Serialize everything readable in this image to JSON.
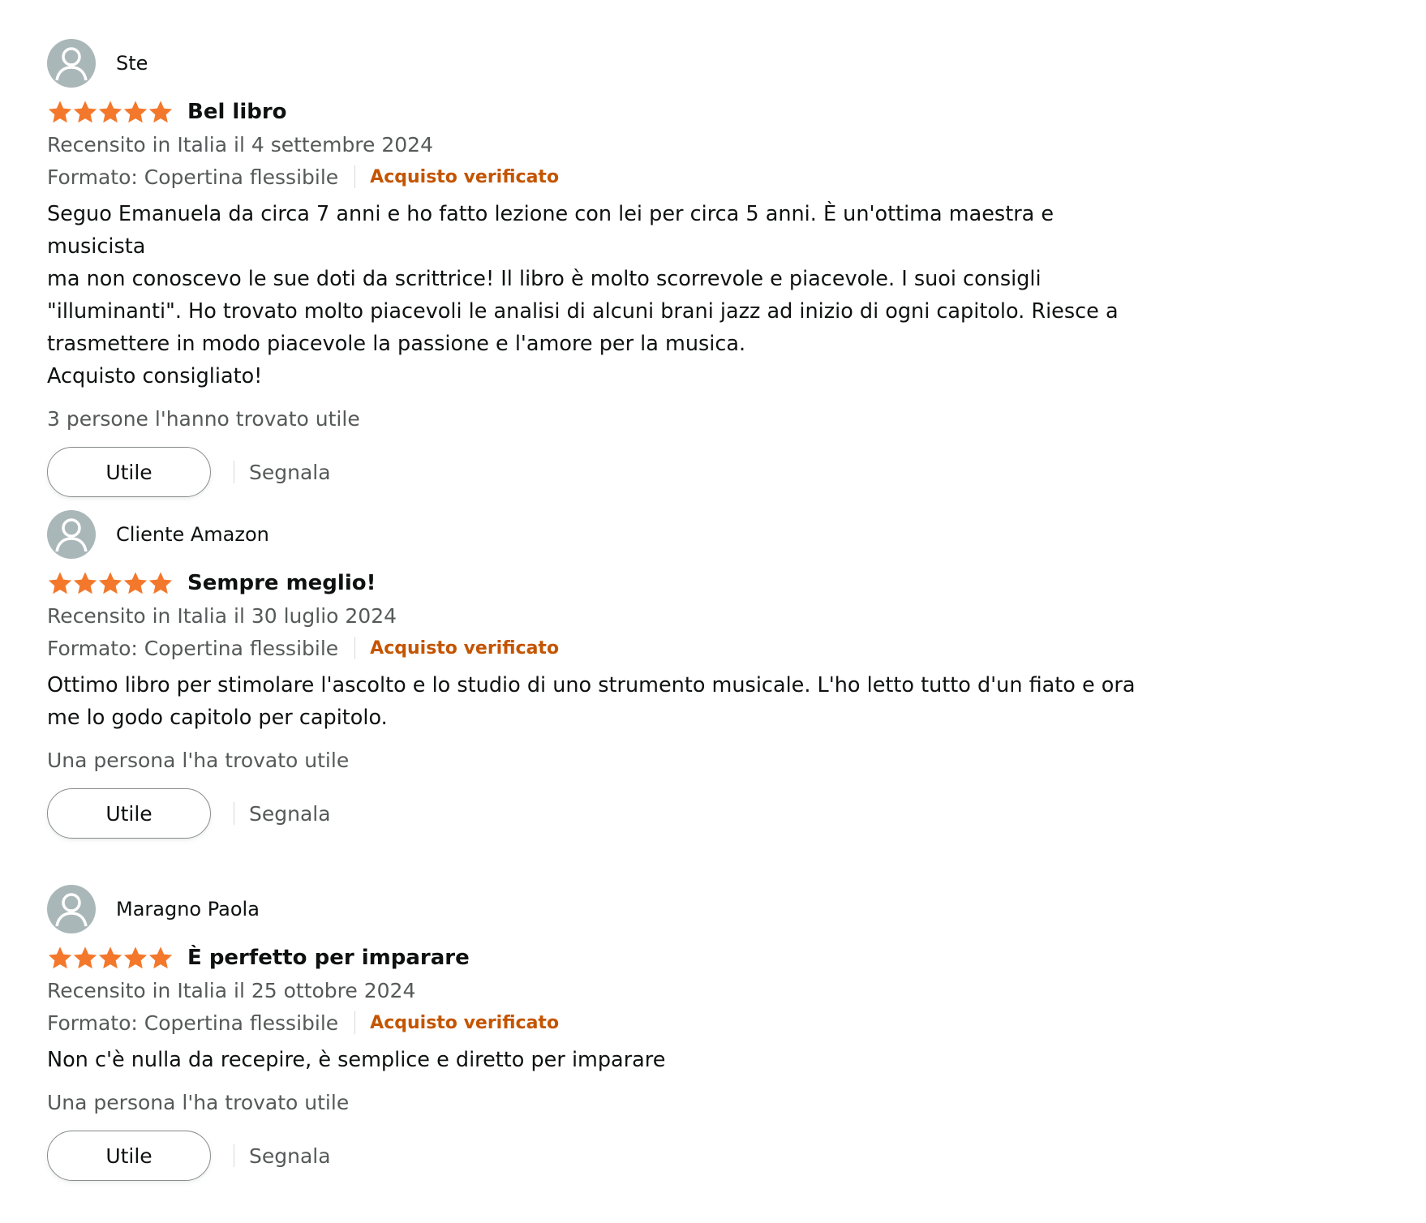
{
  "reviews": [
    {
      "author": "Ste",
      "rating": 5,
      "title": "Bel libro",
      "date": "Recensito in Italia il 4 settembre 2024",
      "format": "Formato: Copertina flessibile",
      "verified": "Acquisto verificato",
      "body": "Seguo Emanuela da circa 7 anni e ho fatto lezione con lei per circa 5 anni. È un'ottima maestra e musicista\nma non conoscevo le sue doti da scrittrice! Il libro è molto scorrevole e piacevole. I suoi consigli\n\"illuminanti\". Ho trovato molto piacevoli le analisi di alcuni brani jazz ad inizio di ogni capitolo. Riesce a\ntrasmettere in modo piacevole la passione e l'amore per la musica.\nAcquisto consigliato!",
      "helpful": "3 persone l'hanno trovato utile",
      "helpful_button": "Utile",
      "report_label": "Segnala"
    },
    {
      "author": "Cliente Amazon",
      "rating": 5,
      "title": "Sempre meglio!",
      "date": "Recensito in Italia il 30 luglio 2024",
      "format": "Formato: Copertina flessibile",
      "verified": "Acquisto verificato",
      "body": "Ottimo libro per stimolare l'ascolto e lo studio di uno strumento musicale. L'ho letto tutto d'un fiato e ora\nme lo godo capitolo per capitolo.",
      "helpful": "Una persona l'ha trovato utile",
      "helpful_button": "Utile",
      "report_label": "Segnala"
    },
    {
      "author": "Maragno Paola",
      "rating": 5,
      "title": "È perfetto per imparare",
      "date": "Recensito in Italia il 25 ottobre 2024",
      "format": "Formato: Copertina flessibile",
      "verified": "Acquisto verificato",
      "body": "Non c'è nulla da recepire, è semplice e diretto per imparare",
      "helpful": "Una persona l'ha trovato utile",
      "helpful_button": "Utile",
      "report_label": "Segnala"
    }
  ],
  "colors": {
    "star": "#f3782b",
    "verified": "#c45500",
    "secondary_text": "#565959",
    "avatar_bg": "#aab7b8"
  },
  "icons": {
    "avatar": "user-avatar-icon",
    "star": "star-icon"
  }
}
